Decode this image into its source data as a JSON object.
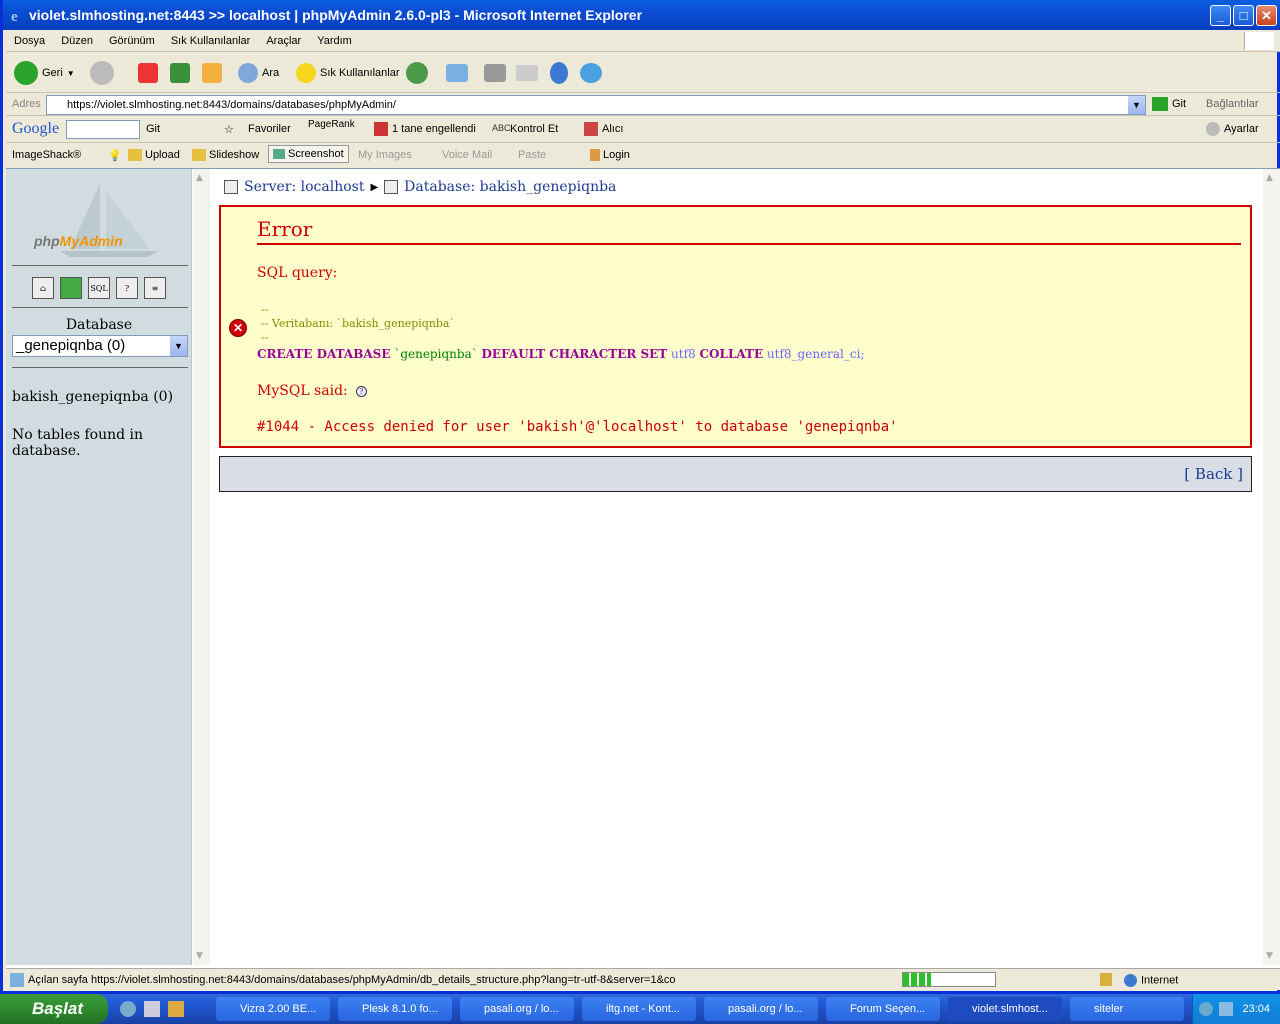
{
  "window": {
    "title": "violet.slmhosting.net:8443 >> localhost | phpMyAdmin 2.6.0-pl3 - Microsoft Internet Explorer"
  },
  "menu": [
    "Dosya",
    "Düzen",
    "Görünüm",
    "Sık Kullanılanlar",
    "Araçlar",
    "Yardım"
  ],
  "toolbar": {
    "back": "Geri",
    "search": "Ara",
    "favorites": "Sık Kullanılanlar"
  },
  "address": {
    "label": "Adres",
    "url": "https://violet.slmhosting.net:8443/domains/databases/phpMyAdmin/",
    "go": "Git",
    "links": "Bağlantılar"
  },
  "google_bar": {
    "brand": "Google",
    "go": "Git",
    "favorites": "Favoriler",
    "pagerank": "PageRank",
    "blocked": "1 tane engellendi",
    "check": "Kontrol Et",
    "send": "Alıcı",
    "settings": "Ayarlar"
  },
  "imageshack_bar": {
    "brand": "ImageShack®",
    "upload": "Upload",
    "slideshow": "Slideshow",
    "screenshot": "Screenshot",
    "my_images": "My Images",
    "voice_mail": "Voice Mail",
    "paste": "Paste",
    "login": "Login"
  },
  "left_panel": {
    "logo_php": "php",
    "logo_my": "My",
    "logo_admin": "Admin",
    "db_label": "Database",
    "db_select": "_genepiqnba (0)",
    "db_name": "bakish_genepiqnba (0)",
    "no_tables": "No tables found in database."
  },
  "breadcrumb": {
    "server": "Server: localhost",
    "database": "Database: bakish_genepiqnba"
  },
  "error": {
    "title": "Error",
    "sql_label": "SQL query:",
    "comment1": "--",
    "comment2": "-- Veritabanı: `bakish_genepiqnba`",
    "comment3": "--",
    "kw1": "CREATE DATABASE",
    "dbname": " `genepiqnba` ",
    "kw2": "DEFAULT CHARACTER SET",
    "charset": " utf8 ",
    "kw3": "COLLATE",
    "collate": " utf8_general_ci;",
    "mysql_said": "MySQL said:",
    "message": "#1044 - Access denied for user 'bakish'@'localhost' to database 'genepiqnba'"
  },
  "back": "[ Back ]",
  "status": {
    "text": "Açılan sayfa https://violet.slmhosting.net:8443/domains/databases/phpMyAdmin/db_details_structure.php?lang=tr-utf-8&server=1&co",
    "zone": "Internet",
    "progress": 0.3
  },
  "taskbar": {
    "start": "Başlat",
    "tasks": [
      "Vizra 2.00 BE...",
      "Plesk 8.1.0 fo...",
      "pasali.org / lo...",
      "iltg.net - Kont...",
      "pasali.org / lo...",
      "Forum Seçen...",
      "violet.slmhost...",
      "siteler"
    ],
    "clock": "23:04"
  },
  "colors": {
    "error": "#cc0000",
    "link": "#1c3b93",
    "panel": "#d0dce0"
  }
}
